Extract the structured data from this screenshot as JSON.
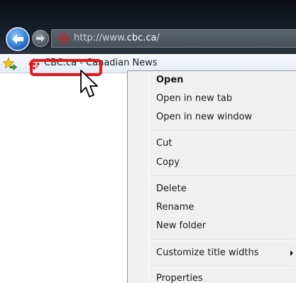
{
  "address_bar": {
    "url_prefix": "http://www.",
    "url_domain": "cbc.ca",
    "url_suffix": "/"
  },
  "favorites_bar": {
    "item_label": "CBC.ca - Canadian News"
  },
  "context_menu": {
    "items": [
      {
        "label": "Open",
        "bold": true
      },
      {
        "label": "Open in new tab"
      },
      {
        "label": "Open in new window"
      },
      {
        "label": "Cut"
      },
      {
        "label": "Copy"
      },
      {
        "label": "Delete"
      },
      {
        "label": "Rename"
      },
      {
        "label": "New folder"
      },
      {
        "label": "Customize title widths",
        "submenu": true
      },
      {
        "label": "Properties"
      }
    ]
  },
  "colors": {
    "highlight_box": "#e01b1b",
    "menu_background": "#f0f0f0",
    "cbc_logo": "#d71920",
    "back_button": "#3d8ee2"
  },
  "icons": [
    "back-arrow-icon",
    "forward-arrow-icon",
    "cbc-logo-icon",
    "favorites-star-icon",
    "pointer-cursor-icon",
    "submenu-arrow-icon"
  ]
}
